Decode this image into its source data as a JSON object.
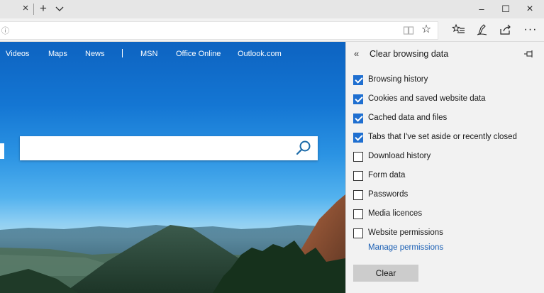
{
  "browser": {
    "tab_close_glyph": "×",
    "new_tab_glyph": "+",
    "window_min_glyph": "–",
    "window_max_glyph": "☐",
    "window_close_glyph": "×",
    "address_info_glyph": "ⓘ",
    "favorite_glyph": "☆",
    "hub_glyph": "✩≡",
    "notes_glyph": "✎",
    "share_glyph": "⇪",
    "more_glyph": "···"
  },
  "page": {
    "nav_links": [
      "Videos",
      "Maps",
      "News",
      "MSN",
      "Office Online",
      "Outlook.com"
    ],
    "search": {
      "value": ""
    }
  },
  "pane": {
    "title": "Clear browsing data",
    "back_glyph": "«",
    "options": [
      {
        "label": "Browsing history",
        "checked": true
      },
      {
        "label": "Cookies and saved website data",
        "checked": true
      },
      {
        "label": "Cached data and files",
        "checked": true
      },
      {
        "label": "Tabs that I've set aside or recently closed",
        "checked": true
      },
      {
        "label": "Download history",
        "checked": false
      },
      {
        "label": "Form data",
        "checked": false
      },
      {
        "label": "Passwords",
        "checked": false
      },
      {
        "label": "Media licences",
        "checked": false
      },
      {
        "label": "Website permissions",
        "checked": false
      }
    ],
    "manage_link": "Manage permissions",
    "clear_button": "Clear"
  },
  "colors": {
    "accent": "#1f6fd0",
    "link": "#1a5fb4",
    "pane_bg": "#f2f2f2",
    "button_bg": "#cccccc"
  },
  "icons": [
    "close-icon",
    "plus-icon",
    "chevron-down-icon",
    "info-icon",
    "reading-view-icon",
    "star-icon",
    "hub-icon",
    "pen-icon",
    "share-icon",
    "more-icon",
    "search-icon",
    "double-chevron-left-icon",
    "pin-icon"
  ]
}
